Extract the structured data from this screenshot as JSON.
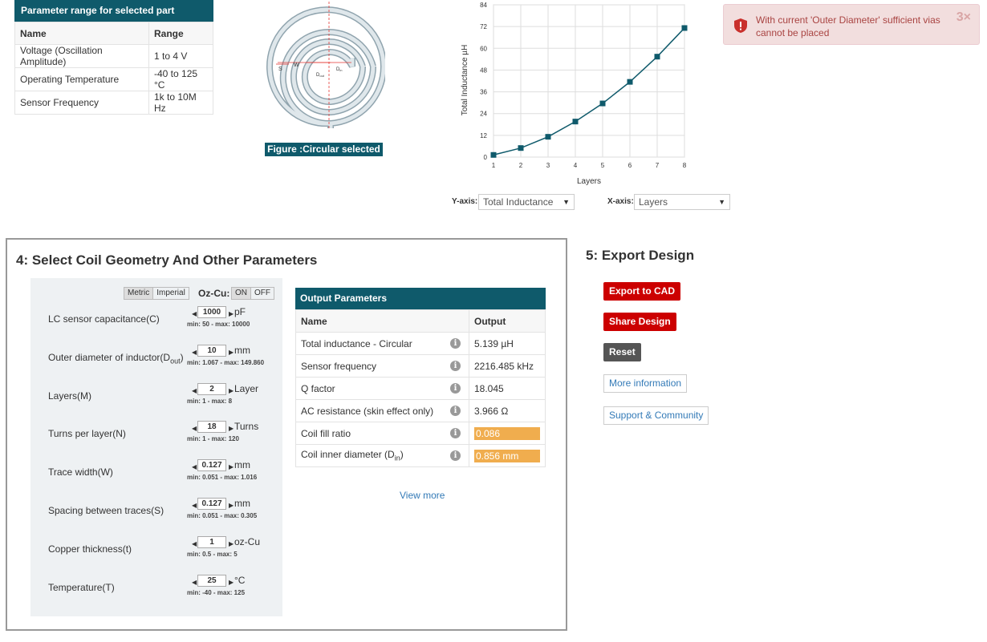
{
  "range_table": {
    "title": "Parameter range for selected part",
    "headers": [
      "Name",
      "Range"
    ],
    "rows": [
      [
        "Voltage (Oscillation Amplitude)",
        "1 to 4 V"
      ],
      [
        "Operating Temperature",
        "-40 to 125 °C"
      ],
      [
        "Sensor Frequency",
        "1k to 10M Hz"
      ]
    ]
  },
  "figure": {
    "caption": "Figure :Circular selected",
    "labels": {
      "s": "S",
      "w": "W",
      "dout": "D",
      "dout_sub": "out",
      "din": "D",
      "din_sub": "in"
    }
  },
  "alert": {
    "message": "With current 'Outer Diameter' sufficient vias cannot be placed",
    "dismiss": "3×"
  },
  "chart_data": {
    "type": "line",
    "x": [
      1,
      2,
      3,
      4,
      5,
      6,
      7,
      8
    ],
    "series": [
      {
        "values": [
          1.2,
          5.0,
          11.2,
          19.6,
          29.6,
          41.5,
          55.4,
          71.2
        ]
      }
    ],
    "xlabel": "Layers",
    "ylabel": "Total Inductance µH",
    "yticks": [
      "0",
      "12",
      "24",
      "36",
      "48",
      "60",
      "72",
      "84"
    ],
    "xticks": [
      "1",
      "2",
      "3",
      "4",
      "5",
      "6",
      "7",
      "8"
    ],
    "xlim": [
      1,
      8
    ],
    "ylim": [
      0,
      84
    ],
    "grid": true,
    "color": "#0f5a6b"
  },
  "axis_select": {
    "y_label": "Y-axis:",
    "y_value": "Total Inductance",
    "x_label": "X-axis:",
    "x_value": "Layers"
  },
  "panel4": {
    "title": "4: Select Coil Geometry And Other Parameters",
    "units_toggle": [
      "Metric",
      "Imperial"
    ],
    "ozcu_label": "Oz-Cu:",
    "ozcu_toggle": [
      "ON",
      "OFF"
    ],
    "params": [
      {
        "label": "LC sensor capacitance(C)",
        "value": "1000",
        "unit": "pF",
        "range": "min: 50 - max: 10000"
      },
      {
        "label": "Outer diameter of inductor(D",
        "sub": "out",
        "label_end": ")",
        "value": "10",
        "unit": "mm",
        "range": "min: 1.067 - max: 149.860"
      },
      {
        "label": "Layers(M)",
        "value": "2",
        "unit": "Layer",
        "range": "min: 1 - max: 8"
      },
      {
        "label": "Turns per layer(N)",
        "value": "18",
        "unit": "Turns",
        "range": "min: 1 - max: 120"
      },
      {
        "label": "Trace width(W)",
        "value": "0.127",
        "unit": "mm",
        "range": "min: 0.051 - max: 1.016"
      },
      {
        "label": "Spacing between traces(S)",
        "value": "0.127",
        "unit": "mm",
        "range": "min: 0.051 - max: 0.305"
      },
      {
        "label": "Copper thickness(t)",
        "value": "1",
        "unit": "oz-Cu",
        "range": "min: 0.5 - max: 5"
      },
      {
        "label": "Temperature(T)",
        "value": "25",
        "unit": "°C",
        "range": "min: -40 - max: 125"
      }
    ]
  },
  "output": {
    "title": "Output Parameters",
    "headers": [
      "Name",
      "Output"
    ],
    "rows": [
      {
        "name": "Total inductance - Circular",
        "value": "5.139 µH",
        "highlight": false
      },
      {
        "name": "Sensor frequency",
        "value": "2216.485 kHz",
        "highlight": false
      },
      {
        "name": "Q factor",
        "value": "18.045",
        "highlight": false
      },
      {
        "name": "AC resistance (skin effect only)",
        "value": "3.966 Ω",
        "highlight": false
      },
      {
        "name": "Coil fill ratio",
        "value": "0.086",
        "highlight": true
      },
      {
        "name": "Coil inner diameter (D",
        "sub": "in",
        "name_end": ")",
        "value": "0.856 mm",
        "highlight": true
      }
    ],
    "info_icon": "i",
    "view_more": "View more"
  },
  "export": {
    "title": "5: Export Design",
    "export_cad": "Export to CAD",
    "share": "Share Design",
    "reset": "Reset",
    "more_info": "More information",
    "support": "Support & Community"
  },
  "colors": {
    "header_teal": "#0f5a6b",
    "button_red": "#cc0000",
    "highlight_orange": "#f0ad4e",
    "alert_bg": "#f2dede"
  }
}
